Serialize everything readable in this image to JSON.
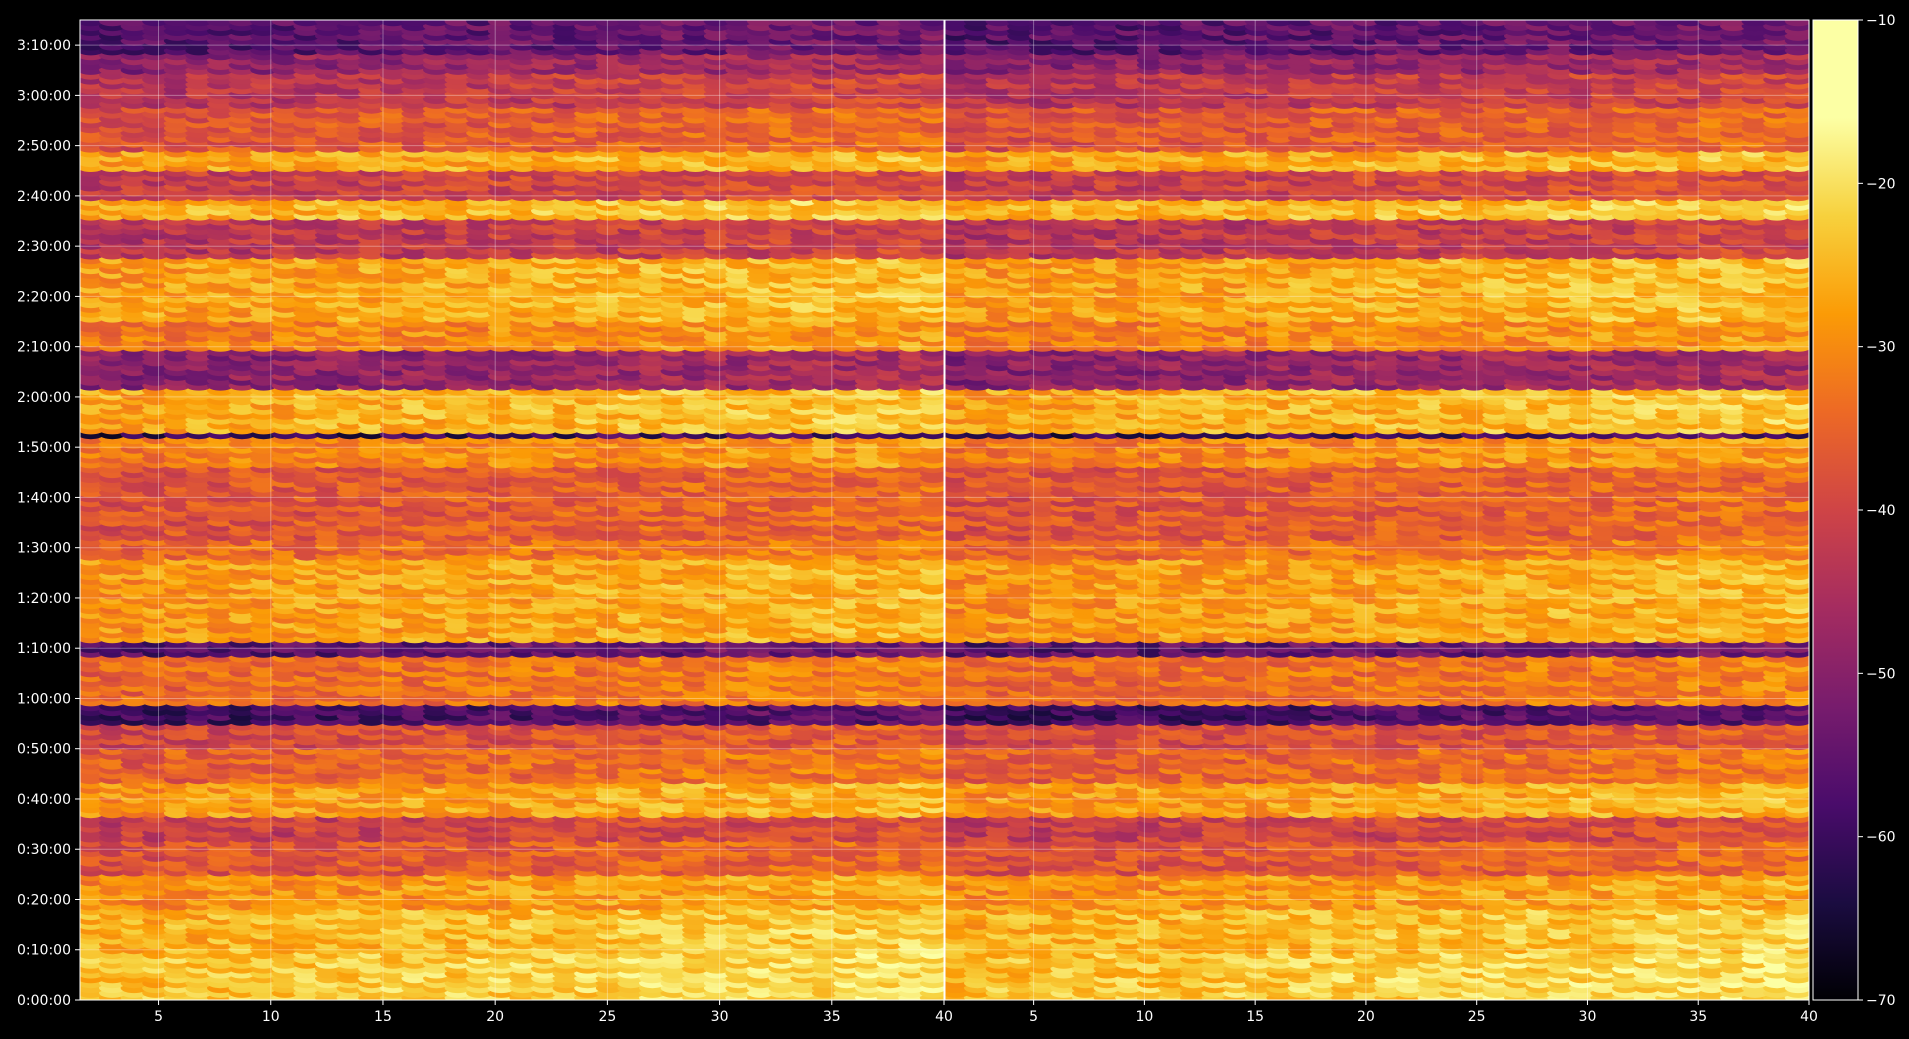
{
  "chart_data": {
    "type": "heatmap",
    "panels": [
      {
        "name": "",
        "x_range": [
          1.5,
          40
        ],
        "x_ticks": [
          5,
          10,
          15,
          20,
          25,
          30,
          35,
          40
        ]
      },
      {
        "name": "",
        "x_range": [
          1,
          40
        ],
        "x_ticks": [
          5,
          10,
          15,
          20,
          25,
          30,
          35,
          40
        ]
      }
    ],
    "y_range_seconds": [
      0,
      11700
    ],
    "y_ticks": [
      {
        "seconds": 0,
        "label": "0:00:00"
      },
      {
        "seconds": 600,
        "label": "0:10:00"
      },
      {
        "seconds": 1200,
        "label": "0:20:00"
      },
      {
        "seconds": 1800,
        "label": "0:30:00"
      },
      {
        "seconds": 2400,
        "label": "0:40:00"
      },
      {
        "seconds": 3000,
        "label": "0:50:00"
      },
      {
        "seconds": 3600,
        "label": "1:00:00"
      },
      {
        "seconds": 4200,
        "label": "1:10:00"
      },
      {
        "seconds": 4800,
        "label": "1:20:00"
      },
      {
        "seconds": 5400,
        "label": "1:30:00"
      },
      {
        "seconds": 6000,
        "label": "1:40:00"
      },
      {
        "seconds": 6600,
        "label": "1:50:00"
      },
      {
        "seconds": 7200,
        "label": "2:00:00"
      },
      {
        "seconds": 7800,
        "label": "2:10:00"
      },
      {
        "seconds": 8400,
        "label": "2:20:00"
      },
      {
        "seconds": 9000,
        "label": "2:30:00"
      },
      {
        "seconds": 9600,
        "label": "2:40:00"
      },
      {
        "seconds": 10200,
        "label": "2:50:00"
      },
      {
        "seconds": 10800,
        "label": "3:00:00"
      },
      {
        "seconds": 11400,
        "label": "3:10:00"
      }
    ],
    "colorbar": {
      "colormap": "inferno",
      "range": [
        -70,
        -10
      ],
      "ticks": [
        -10,
        -20,
        -30,
        -40,
        -50,
        -60,
        -70
      ],
      "tick_labels": [
        "−10",
        "−20",
        "−30",
        "−40",
        "−50",
        "−60",
        "−70"
      ]
    },
    "row_profile": {
      "description_units": "approximate level (dB) per time band, bottom to top",
      "bands": [
        {
          "t_start": 0,
          "t_end": 600,
          "level": -22
        },
        {
          "t_start": 600,
          "t_end": 1100,
          "level": -24
        },
        {
          "t_start": 1100,
          "t_end": 1500,
          "level": -28
        },
        {
          "t_start": 1500,
          "t_end": 1900,
          "level": -36
        },
        {
          "t_start": 1900,
          "t_end": 2200,
          "level": -40
        },
        {
          "t_start": 2200,
          "t_end": 2600,
          "level": -27
        },
        {
          "t_start": 2600,
          "t_end": 3000,
          "level": -34
        },
        {
          "t_start": 3000,
          "t_end": 3300,
          "level": -38
        },
        {
          "t_start": 3300,
          "t_end": 3550,
          "level": -58
        },
        {
          "t_start": 3550,
          "t_end": 4100,
          "level": -33
        },
        {
          "t_start": 4100,
          "t_end": 4300,
          "level": -55
        },
        {
          "t_start": 4300,
          "t_end": 5250,
          "level": -27
        },
        {
          "t_start": 5250,
          "t_end": 5500,
          "level": -33
        },
        {
          "t_start": 5500,
          "t_end": 6400,
          "level": -36
        },
        {
          "t_start": 6400,
          "t_end": 6700,
          "level": -30
        },
        {
          "t_start": 6700,
          "t_end": 6800,
          "level": -60
        },
        {
          "t_start": 6800,
          "t_end": 7300,
          "level": -25
        },
        {
          "t_start": 7300,
          "t_end": 7750,
          "level": -48
        },
        {
          "t_start": 7750,
          "t_end": 8100,
          "level": -30
        },
        {
          "t_start": 8100,
          "t_end": 8900,
          "level": -26
        },
        {
          "t_start": 8900,
          "t_end": 9350,
          "level": -42
        },
        {
          "t_start": 9350,
          "t_end": 9550,
          "level": -24
        },
        {
          "t_start": 9550,
          "t_end": 9900,
          "level": -40
        },
        {
          "t_start": 9900,
          "t_end": 10150,
          "level": -26
        },
        {
          "t_start": 10150,
          "t_end": 10700,
          "level": -36
        },
        {
          "t_start": 10700,
          "t_end": 11100,
          "level": -42
        },
        {
          "t_start": 11100,
          "t_end": 11300,
          "level": -48
        },
        {
          "t_start": 11300,
          "t_end": 11700,
          "level": -55
        }
      ]
    },
    "grid": true,
    "colors": {
      "background": "#000000",
      "axes_line": "#ffffff",
      "grid": "#ffffff"
    }
  }
}
